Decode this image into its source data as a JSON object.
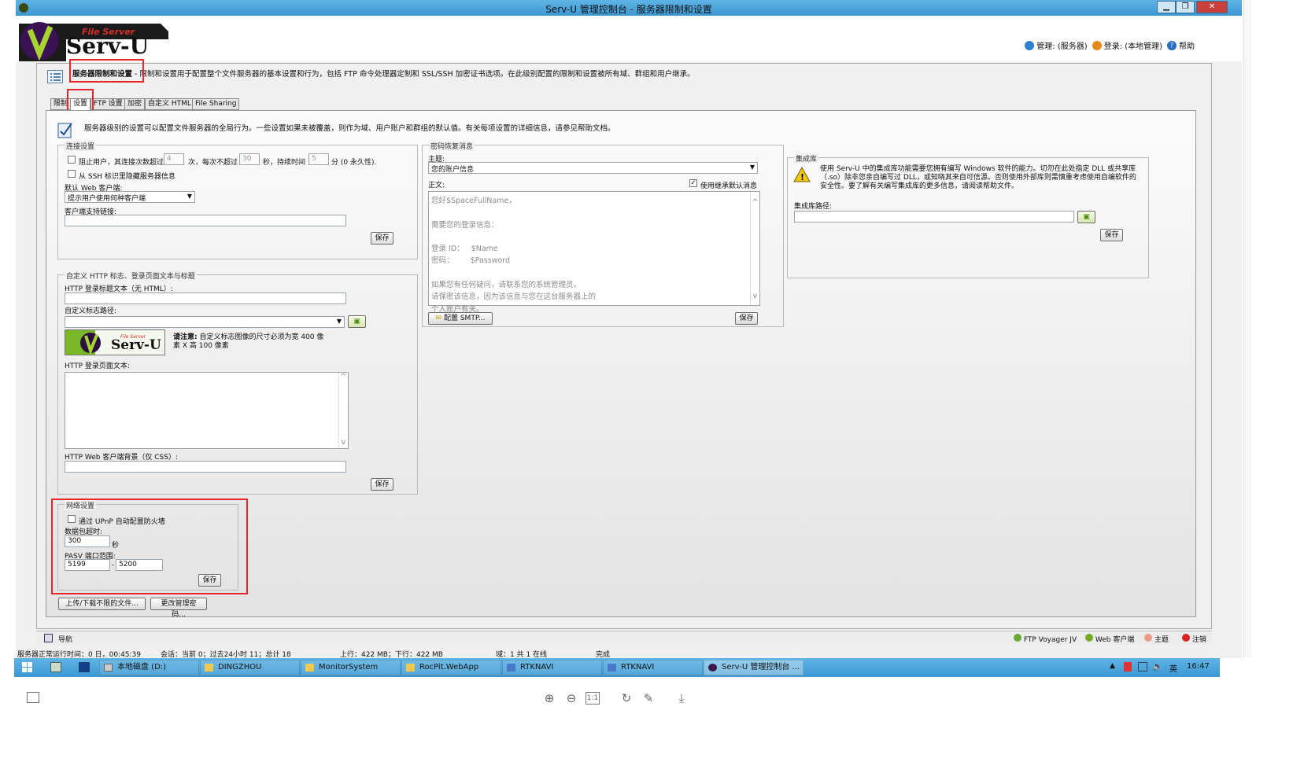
{
  "window": {
    "title": "Serv-U 管理控制台 - 服务器限制和设置",
    "min": "▁",
    "restore": "❐",
    "close": "✕"
  },
  "logo": {
    "top": "File Server",
    "main": "Serv-U"
  },
  "toplinks": {
    "admin": "管理: (服务器)",
    "login": "登录: (本地管理)",
    "help": "帮助"
  },
  "page": {
    "title": "服务器限制和设置",
    "desc": " - 限制和设置用于配置整个文件服务器的基本设置和行为，包括 FTP 命令处理器定制和 SSL/SSH 加密证书选项。在此级别配置的限制和设置被所有域、群组和用户继承。"
  },
  "tabs": [
    "限制",
    "设置",
    "FTP 设置",
    "加密",
    "自定义 HTML",
    "File Sharing"
  ],
  "settings_intro": "服务器级别的设置可以配置文件服务器的全局行为。一些设置如果未被覆盖，则作为域、用户账户和群组的默认值。有关每项设置的详细信息，请参见帮助文档。",
  "connection": {
    "title": "连接设置",
    "block_pre": "阻止用户，其连接次数超过",
    "block_count": "4",
    "block_mid": "次，每次不超过",
    "block_seconds": "30",
    "block_mid2": "秒，持续时间",
    "block_minutes": "5",
    "block_post": "分 (0 永久性).",
    "ssh_hide": "从 SSH 标识里隐藏服务器信息",
    "web_client_label": "默认 Web 客户端:",
    "web_client_value": "提示用户使用何种客户端",
    "support_link_label": "客户端支持链接:",
    "save": "保存"
  },
  "password_recovery": {
    "title": "密码恢复消息",
    "subject_label": "主题:",
    "subject_value": "您的账户信息",
    "body_label": "正文:",
    "inherit": "使用继承默认消息",
    "body_lines": [
      "您好$SpaceFullName，",
      "",
      "需要您的登录信息：",
      "",
      "登录 ID：   $Name",
      "密码：       $Password",
      "",
      "如果您有任何疑问，请联系您的系统管理员。",
      "请保密该信息，因为该信息与您在这台服务器上的",
      "个人账户有关。"
    ],
    "smtp": "配置 SMTP...",
    "save": "保存"
  },
  "library": {
    "title": "集成库",
    "notice": "使用 Serv-U 中的集成库功能需要您拥有编写 Windows 软件的能力。切勿在此处指定 DLL 或共享库（.so）除非您亲自编写过 DLL，或知晓其来自可信源。否则使用外部库则需慎重考虑使用自编软件的安全性。要了解有关编写集成库的更多信息，请阅读帮助文件。",
    "path_label": "集成库路径:",
    "save": "保存"
  },
  "custom_http": {
    "title": "自定义 HTTP 标志、登录页面文本与标题",
    "login_title_label": "HTTP 登录标题文本（无 HTML）:",
    "logo_path_label": "自定义标志路径:",
    "note_bold": "请注意:",
    "note": "自定义标志图像的尺寸必须为宽 400 像素 X 高 100 像素",
    "login_text_label": "HTTP 登录页面文本:",
    "css_label": "HTTP Web 客户端背景（仅 CSS）:",
    "save": "保存"
  },
  "network": {
    "title": "网络设置",
    "upnp": "通过 UPnP 自动配置防火墙",
    "timeout_label": "数据包超时:",
    "timeout_value": "300",
    "timeout_unit": "秒",
    "pasv_label": "PASV 端口范围:",
    "pasv_from": "5199",
    "pasv_to": "5200",
    "save": "保存"
  },
  "bottom_buttons": {
    "unlimited": "上传/下载不限的文件...",
    "change_pw": "更改管理密码..."
  },
  "navbar": {
    "nav": "导航",
    "ftp_voyager": "FTP Voyager JV",
    "web_client": "Web 客户端",
    "theme": "主题",
    "logout": "注销"
  },
  "statusbar": {
    "uptime": "服务器正常运行时间：0 日，00:45:39",
    "sessions": "会话：当前 0；过去24小时 11；总计 18",
    "traffic": "上行：422 MB；下行：422 MB",
    "domains": "域：1 共 1 在线",
    "state": "完成"
  },
  "taskbar": {
    "items": [
      "本地磁盘 (D:)",
      "DINGZHOU",
      "MonitorSystem",
      "RocPit.WebApp",
      "RTKNAVI",
      "RTKNAVI",
      "Serv-U 管理控制台 ..."
    ],
    "ime": "英",
    "time": "16:47"
  },
  "viewer": {
    "zoom_in": "⊕",
    "zoom_out": "⊖",
    "actual": "1:1",
    "rotate": "↻",
    "edit": "✎",
    "download": "⤓"
  }
}
